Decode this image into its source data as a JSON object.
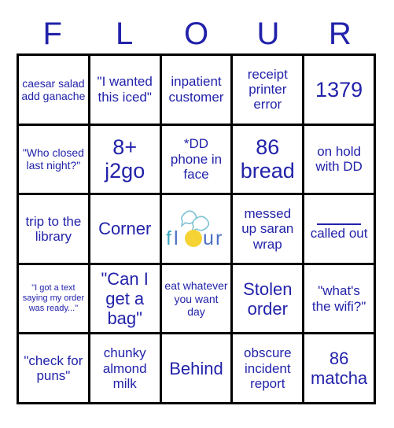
{
  "header": {
    "letters": [
      "F",
      "L",
      "O",
      "U",
      "R"
    ]
  },
  "grid": {
    "rows": [
      [
        {
          "text": "caesar salad add ganache",
          "size": "s"
        },
        {
          "text": "\"I wanted this iced\"",
          "size": "m"
        },
        {
          "text": "inpatient customer",
          "size": "m"
        },
        {
          "text": "receipt printer error",
          "size": "m"
        },
        {
          "text": "1379",
          "size": "xl"
        }
      ],
      [
        {
          "text": "\"Who closed last night?\"",
          "size": "s"
        },
        {
          "text": "8+ j2go",
          "size": "xl"
        },
        {
          "text": "*DD phone in face",
          "size": "m"
        },
        {
          "text": "86 bread",
          "size": "xl"
        },
        {
          "text": "on hold with DD",
          "size": "m"
        }
      ],
      [
        {
          "text": "trip to the library",
          "size": "m"
        },
        {
          "text": "Corner",
          "size": "l"
        },
        {
          "type": "logo",
          "logo_text": "flour",
          "text": "flour"
        },
        {
          "text": "messed up saran wrap",
          "size": "m"
        },
        {
          "type": "blank",
          "text": "called out",
          "size": "m"
        }
      ],
      [
        {
          "text": "\"I got a text saying my order was ready...\"",
          "size": "xs"
        },
        {
          "text": "\"Can I get a bag\"",
          "size": "l"
        },
        {
          "text": "eat whatever you want day",
          "size": "s"
        },
        {
          "text": "Stolen order",
          "size": "l"
        },
        {
          "text": "\"what's the wifi?\"",
          "size": "m"
        }
      ],
      [
        {
          "text": "\"check for puns\"",
          "size": "m"
        },
        {
          "text": "chunky almond milk",
          "size": "m"
        },
        {
          "text": "Behind",
          "size": "l"
        },
        {
          "text": "obscure incident report",
          "size": "m"
        },
        {
          "text": "86 matcha",
          "size": "l"
        }
      ]
    ]
  },
  "colors": {
    "text_blue": "#2222aa",
    "grid_black": "#000000",
    "background": "#ffffff",
    "logo_teal": "#3fa9bf",
    "logo_blue": "#4a6fc4",
    "logo_yellow": "#f6d335"
  }
}
